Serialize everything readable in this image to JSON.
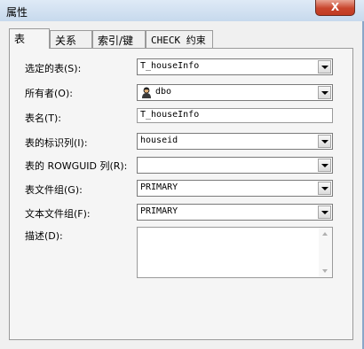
{
  "window": {
    "title": "属性",
    "close_label": "X"
  },
  "tabs": [
    {
      "label": "表"
    },
    {
      "label": "关系"
    },
    {
      "label": "索引/键"
    },
    {
      "label": "CHECK 约束"
    }
  ],
  "form": {
    "selected_table_label": "选定的表(S):",
    "selected_table_value": "T_houseInfo",
    "owner_label": "所有者(O):",
    "owner_value": "dbo",
    "table_name_label": "表名(T):",
    "table_name_value": "T_houseInfo",
    "identity_col_label": "表的标识列(I):",
    "identity_col_value": "houseid",
    "rowguid_label": "表的 ROWGUID 列(R):",
    "rowguid_value": "",
    "filegroup_label": "表文件组(G):",
    "filegroup_value": "PRIMARY",
    "text_filegroup_label": "文本文件组(F):",
    "text_filegroup_value": "PRIMARY",
    "description_label": "描述(D):",
    "description_value": ""
  },
  "icons": {
    "owner": "user-icon",
    "dropdown": "chevron-down-icon"
  }
}
